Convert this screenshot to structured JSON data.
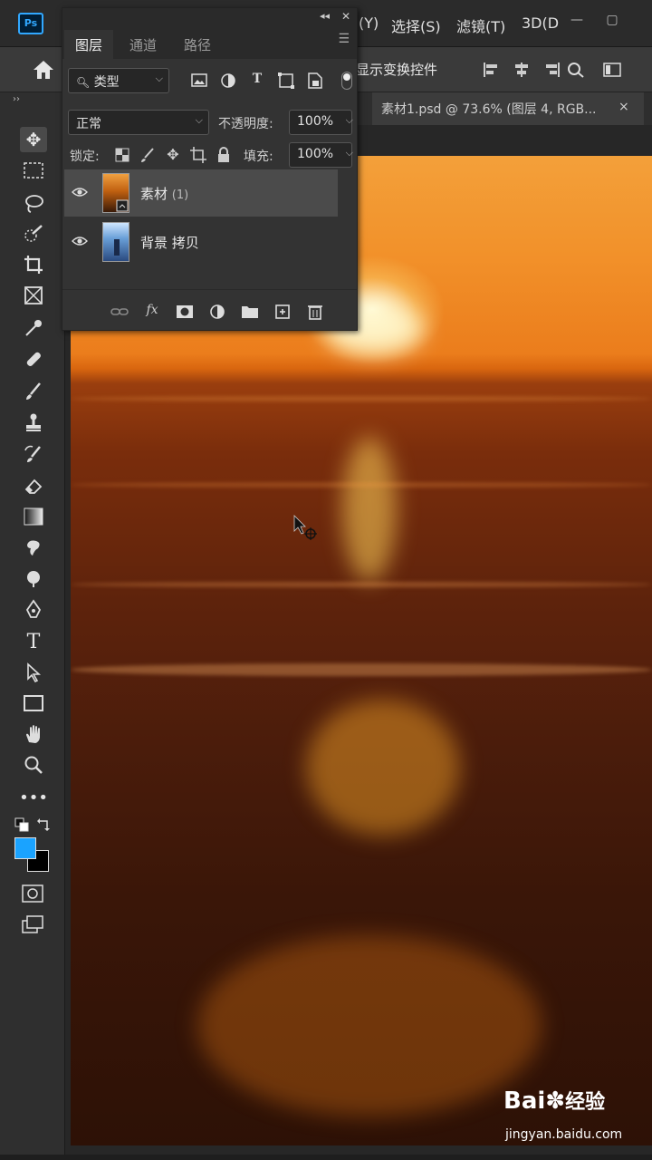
{
  "app": {
    "logo": "Ps",
    "menu": [
      "(Y)",
      "选择(S)",
      "滤镜(T)",
      "3D(D"
    ]
  },
  "options_bar": {
    "show_transform_label": "显示变换控件"
  },
  "document_tab": {
    "title": "素材1.psd @ 73.6% (图层 4, RGB...",
    "close": "×"
  },
  "layers_panel": {
    "tabs": [
      "图层",
      "通道",
      "路径"
    ],
    "filter": {
      "label": "类型"
    },
    "blend_mode": "正常",
    "opacity_label": "不透明度:",
    "opacity_value": "100%",
    "lock_label": "锁定:",
    "fill_label": "填充:",
    "fill_value": "100%",
    "layers": [
      {
        "name": "素材",
        "suffix": "(1)",
        "visible": true,
        "selected": true
      },
      {
        "name": "背景 拷贝",
        "suffix": "",
        "visible": true,
        "selected": false
      }
    ],
    "bottom_icons": [
      "link-icon",
      "fx-icon",
      "mask-icon",
      "adjustment-icon",
      "folder-icon",
      "new-layer-icon",
      "trash-icon"
    ],
    "fx_label": "fx"
  },
  "toolbar": {
    "colors": {
      "foreground": "#1aa3ff",
      "background": "#000000"
    }
  },
  "watermark": {
    "brand": "Bai",
    "brand2": "经验",
    "url": "jingyan.baidu.com"
  }
}
